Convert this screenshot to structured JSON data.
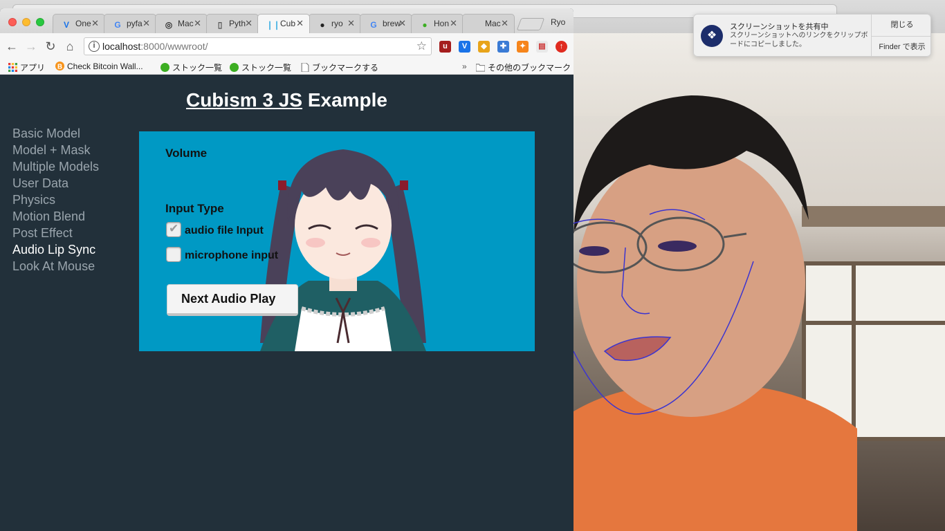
{
  "browser": {
    "tabs": [
      {
        "label": "One",
        "icon": "v-logo-icon",
        "glyph": "V",
        "color": "#1a73e8",
        "active": false
      },
      {
        "label": "pyfa",
        "icon": "google-icon",
        "glyph": "G",
        "color": "#4285f4",
        "active": false
      },
      {
        "label": "Mac",
        "icon": "stop-icon",
        "glyph": "◎",
        "color": "#333333",
        "active": false
      },
      {
        "label": "Pyth",
        "icon": "document-icon",
        "glyph": "▯",
        "color": "#555555",
        "active": false
      },
      {
        "label": "Cub",
        "icon": "cubism-icon",
        "glyph": "❘❘",
        "color": "#2aa7e0",
        "active": true
      },
      {
        "label": "ryo",
        "icon": "github-icon",
        "glyph": "●",
        "color": "#222222",
        "active": false
      },
      {
        "label": "brew",
        "icon": "google-icon",
        "glyph": "G",
        "color": "#4285f4",
        "active": false
      },
      {
        "label": "Hon",
        "icon": "green-circle-icon",
        "glyph": "●",
        "color": "#3cae22",
        "active": false
      },
      {
        "label": "Mac",
        "icon": "apple-icon",
        "glyph": "",
        "color": "#555555",
        "active": false
      }
    ],
    "profile_name": "Ryo",
    "url_host": "localhost",
    "url_path": ":8000/wwwroot/",
    "info_glyph": "i",
    "bookmarks": [
      {
        "label": "アプリ",
        "icon": "apps-grid-icon"
      },
      {
        "label": "Check Bitcoin Wall...",
        "icon": "bitcoin-icon"
      },
      {
        "label": "ストック一覧",
        "icon": "green-circle-icon"
      },
      {
        "label": "ストック一覧",
        "icon": "green-circle-icon"
      },
      {
        "label": "ブックマークする",
        "icon": "document-icon"
      }
    ],
    "other_bookmarks": "その他のブックマーク",
    "overflow": "»"
  },
  "page": {
    "title_link": "Cubism 3 JS",
    "title_rest": " Example",
    "nav": [
      {
        "label": "Basic Model",
        "active": false
      },
      {
        "label": "Model + Mask",
        "active": false
      },
      {
        "label": "Multiple Models",
        "active": false
      },
      {
        "label": "User Data",
        "active": false
      },
      {
        "label": "Physics",
        "active": false
      },
      {
        "label": "Motion Blend",
        "active": false
      },
      {
        "label": "Post Effect",
        "active": false
      },
      {
        "label": "Audio Lip Sync",
        "active": true
      },
      {
        "label": "Look At Mouse",
        "active": false
      }
    ],
    "controls": {
      "volume_label": "Volume",
      "input_type_label": "Input Type",
      "audio_file_label": "audio file Input",
      "audio_file_checked": true,
      "microphone_label": "microphone input",
      "microphone_checked": false,
      "next_audio_button": "Next Audio Play"
    }
  },
  "notification": {
    "title": "スクリーンショットを共有中",
    "body": "スクリーンショットへのリンクをクリップボードにコピーしました。",
    "close_button": "閉じる",
    "finder_button": "Finder で表示",
    "icon": "dropbox-icon"
  },
  "colors": {
    "page_bg": "#22303a",
    "stage_bg": "#0099c4",
    "nav_active": "#ffffff",
    "nav_inactive": "#9aa5ad"
  }
}
